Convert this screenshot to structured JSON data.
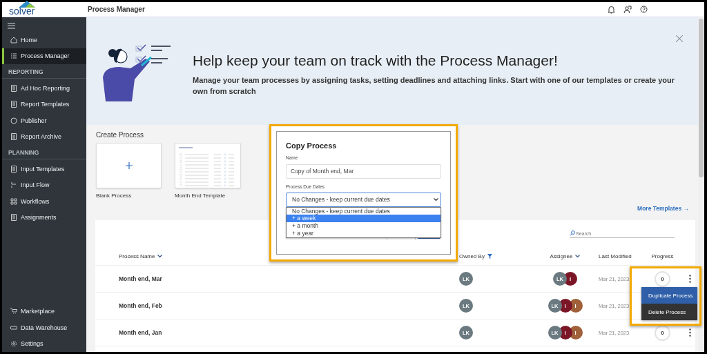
{
  "app": {
    "logo": "solver",
    "title": "Process Manager"
  },
  "sidebar": {
    "top": [
      {
        "label": "Home",
        "selected": false
      },
      {
        "label": "Process Manager",
        "selected": true
      }
    ],
    "sections": [
      {
        "heading": "REPORTING",
        "items": [
          {
            "label": "Ad Hoc Reporting",
            "selected": false
          },
          {
            "label": "Report Templates",
            "selected": false
          },
          {
            "label": "Publisher",
            "selected": false
          },
          {
            "label": "Report Archive",
            "selected": false
          }
        ]
      },
      {
        "heading": "PLANNING",
        "items": [
          {
            "label": "Input Templates",
            "selected": false
          },
          {
            "label": "Input Flow",
            "selected": false
          },
          {
            "label": "Workflows",
            "selected": false
          },
          {
            "label": "Assignments",
            "selected": false
          }
        ]
      }
    ],
    "bottom": [
      {
        "label": "Marketplace",
        "selected": false
      },
      {
        "label": "Data Warehouse",
        "selected": false
      },
      {
        "label": "Settings",
        "selected": false
      }
    ]
  },
  "banner": {
    "title": "Help keep your team on track with the Process Manager!",
    "text": "Manage your team processes by assigning tasks, setting deadlines and attaching links. Start with one of our templates or create your own from scratch"
  },
  "create_process": {
    "title": "Create Process",
    "templates": [
      {
        "kind": "blank",
        "label": "Blank Process"
      },
      {
        "kind": "template",
        "label": "Month End Template"
      }
    ],
    "more_link": "More Templates →"
  },
  "table": {
    "search": {
      "placeholder": "Search"
    },
    "columns": [
      {
        "label": "Process Name",
        "kind": "sort"
      },
      {
        "label": "Owned By",
        "kind": "filter"
      },
      {
        "label": "Assignee",
        "kind": "sort"
      },
      {
        "label": "Last Modified",
        "kind": "plain"
      },
      {
        "label": "Progress",
        "kind": "plain"
      }
    ],
    "rows": [
      {
        "name": "Month end, Mar",
        "owner": "LK",
        "assignees": [
          {
            "initials": "LK",
            "color": "#6b7a80"
          },
          {
            "initials": "I",
            "color": "#7b1626"
          }
        ],
        "modified": "Mar 21, 2023",
        "progress": "0"
      },
      {
        "name": "Month end, Feb",
        "owner": "LK",
        "assignees": [
          {
            "initials": "LK",
            "color": "#6b7a80"
          },
          {
            "initials": "I",
            "color": "#7b1626"
          },
          {
            "initials": "I",
            "color": "#a0603a"
          }
        ],
        "modified": "Mar 21, 2023"
      },
      {
        "name": "Month end, Jan",
        "owner": "LK",
        "assignees": [
          {
            "initials": "LK",
            "color": "#6b7a80"
          },
          {
            "initials": "I",
            "color": "#7b1626"
          },
          {
            "initials": "I",
            "color": "#a0603a"
          }
        ],
        "modified": "Mar 21, 2023",
        "progress": "0"
      }
    ]
  },
  "copy_dialog": {
    "title": "Copy Process",
    "name_label": "Name",
    "name_value": "Copy of Month end, Mar",
    "due_label": "Process Due Dates",
    "due_value": "No Changes - keep current due dates",
    "options": [
      {
        "label": "No Changes - keep current due dates",
        "selected": false
      },
      {
        "label": "+ a week",
        "selected": true
      },
      {
        "label": "+ a month",
        "selected": false
      },
      {
        "label": "+ a year",
        "selected": false
      }
    ]
  },
  "row_menu": {
    "items": [
      {
        "label": "Duplicate Process",
        "selected": true
      },
      {
        "label": "Delete Process",
        "selected": false
      }
    ]
  }
}
